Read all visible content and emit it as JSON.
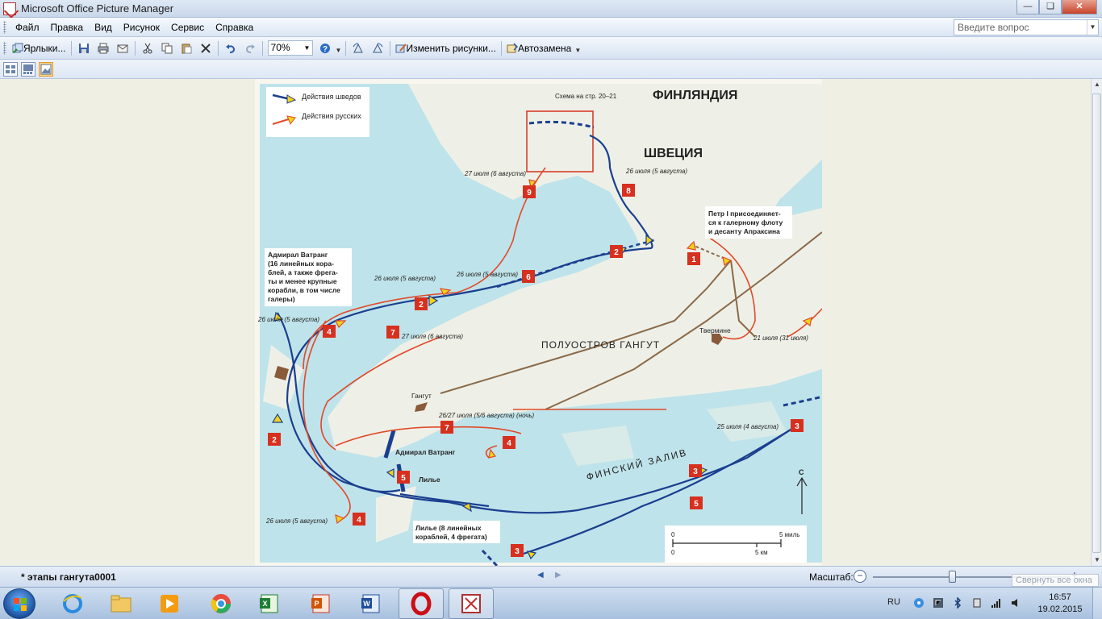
{
  "window": {
    "title": "Microsoft Office Picture Manager",
    "minimize": "—",
    "maximize": "❏",
    "close": "✕"
  },
  "menu": {
    "items": [
      "Файл",
      "Правка",
      "Вид",
      "Рисунок",
      "Сервис",
      "Справка"
    ],
    "help_placeholder": "Введите вопрос"
  },
  "toolbar": {
    "shortcuts_label": "Ярлыки...",
    "zoom_value": "70%",
    "edit_pictures_label": "Изменить рисунки...",
    "autocorrect_label": "Автозамена"
  },
  "map": {
    "legend": {
      "swedish": "Действия шведов",
      "russian": "Действия русских"
    },
    "regions": {
      "finland": "ФИНЛЯНДИЯ",
      "sweden": "ШВЕЦИЯ",
      "peninsula": "ПОЛУОСТРОВ ГАНГУТ",
      "gulf": "ФИНСКИЙ ЗАЛИВ"
    },
    "places": {
      "scheme": "Схема на стр. 20–21",
      "tverminne": "Твермине",
      "gangut": "Гангут"
    },
    "notes": {
      "peter": [
        "Петр I присоединяет-",
        "ся к галерному флоту",
        "и десанту Апраксина"
      ],
      "watrang_fleet": [
        "Адмирал Ватранг",
        "(16 линейных кора-",
        "блей, а также фрега-",
        "ты и менее крупные",
        "корабли, в том числе",
        "галеры)"
      ],
      "lilje_fleet": [
        "Лилье (8 линейных",
        "кораблей, 4 фрегата)"
      ],
      "admiral_watrang": "Адмирал Ватранг",
      "lilje": "Лилье"
    },
    "dates": {
      "d27_jul_6_aug_top": "27 июля (6 августа)",
      "d26_jul_5_aug_right": "26 июля (5 августа)",
      "d26_jul_5_aug_mid": "26 июля (5 августа)",
      "d26_jul_5_aug_mid2": "26 июля (5 августа)",
      "d26_jul_5_aug_left": "26 июля (5 августа)",
      "d27_jul_6_aug_mid": "27 июля (6 августа)",
      "d21_jul": "21 июля (31 июля)",
      "d26_27_night": "26/27 июля (5/6 августа) (ночь)",
      "d25_jul": "25 июля (4 августа)",
      "d26_jul_bottom": "26 июля (5 августа)"
    },
    "markers": {
      "m1": "1",
      "m2a": "2",
      "m2b": "2",
      "m2c": "2",
      "m3a": "3",
      "m3b": "3",
      "m3c": "3",
      "m4a": "4",
      "m4b": "4",
      "m4c": "4",
      "m5a": "5",
      "m5b": "5",
      "m6": "6",
      "m7a": "7",
      "m7b": "7",
      "m8": "8",
      "m9": "9"
    },
    "scale": {
      "zero_top": "0",
      "five_miles": "5 миль",
      "zero_bottom": "0",
      "five_km": "5 км"
    },
    "north": "С",
    "colors": {
      "sea": "#bfe3ea",
      "land": "#eef0e7",
      "swedish": "#1b3f8f",
      "russian": "#e04a2a",
      "arrow_fill": "#f2d21a",
      "marker": "#d7301f"
    }
  },
  "status": {
    "file_name": "* этапы гангута0001",
    "zoom_label": "Масштаб:",
    "tooltip": "Свернуть все окна"
  },
  "taskbar": {
    "lang": "RU",
    "time": "16:57",
    "date": "19.02.2015"
  }
}
